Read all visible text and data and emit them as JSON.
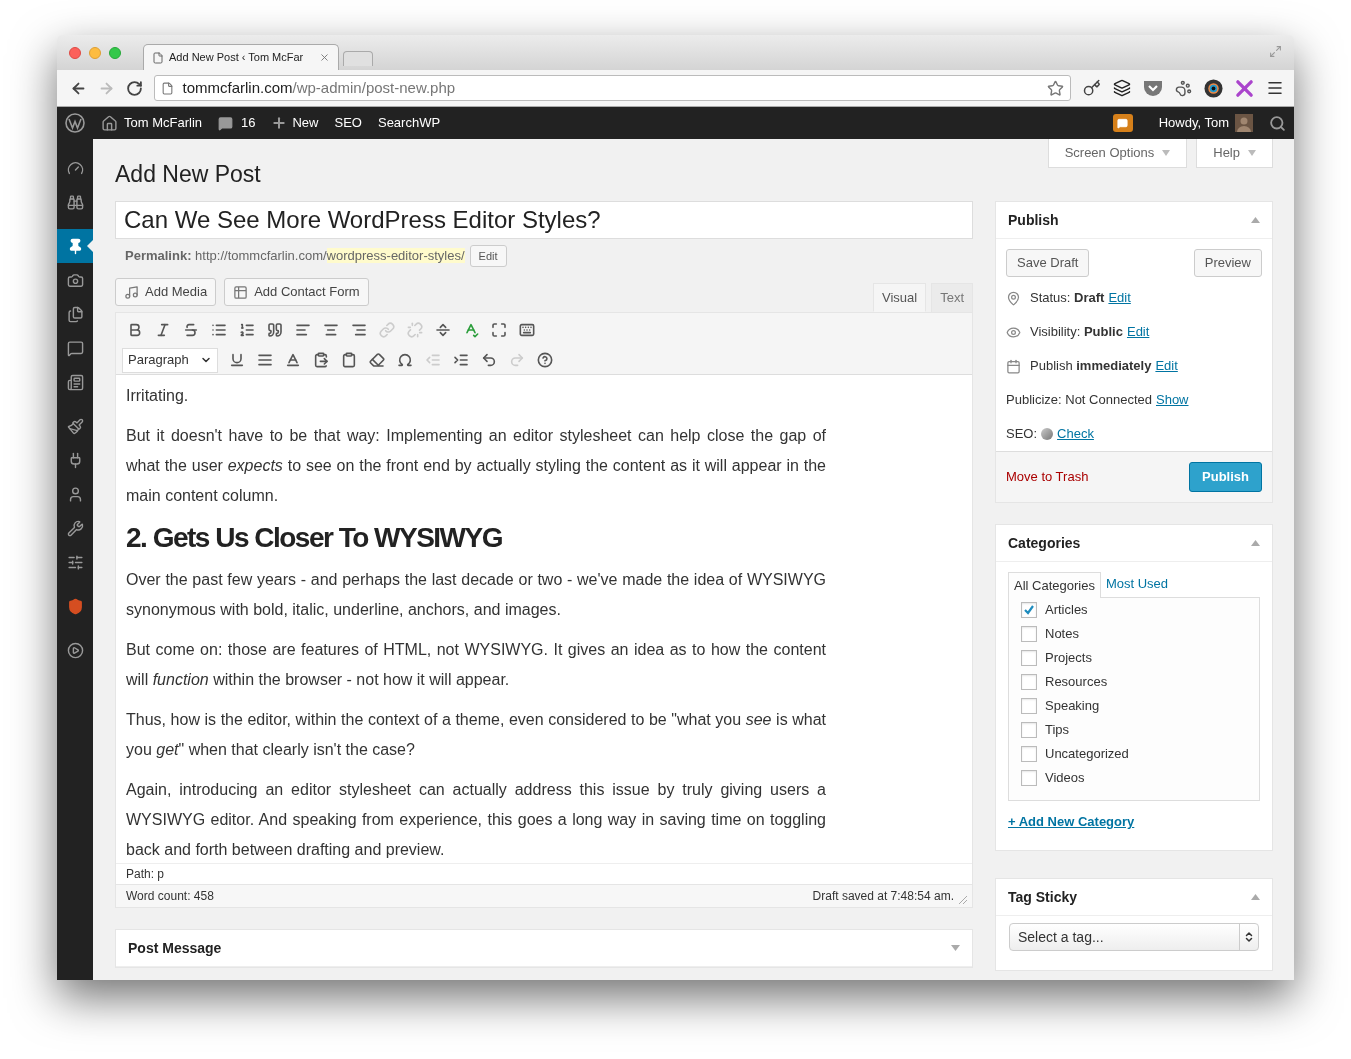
{
  "browser": {
    "tab_title": "Add New Post ‹ Tom McFar",
    "nav": [
      {
        "kind": "back",
        "disabled": false
      },
      {
        "kind": "forward",
        "disabled": true
      },
      {
        "kind": "reload",
        "disabled": false
      }
    ],
    "url_host": "tommcfarlin.com",
    "url_path": "/wp-admin/post-new.php",
    "extensions": [
      {
        "kind": "key"
      },
      {
        "kind": "layers"
      },
      {
        "kind": "pocket"
      },
      {
        "kind": "paw"
      },
      {
        "kind": "lens"
      },
      {
        "kind": "cross"
      },
      {
        "kind": "menu"
      }
    ]
  },
  "admin_bar": {
    "site": "Tom McFarlin",
    "comments": "16",
    "new": "New",
    "items": [
      "SEO",
      "SearchWP"
    ],
    "howdy": "Howdy, Tom"
  },
  "sidebar": {
    "groups": [
      [
        {
          "kind": "dashboard",
          "selected": false
        },
        {
          "kind": "binoculars",
          "selected": false
        }
      ],
      [
        {
          "kind": "posts",
          "selected": true
        },
        {
          "kind": "media",
          "selected": false
        },
        {
          "kind": "pages",
          "selected": false
        },
        {
          "kind": "comments",
          "selected": false
        },
        {
          "kind": "forms",
          "selected": false
        }
      ],
      [
        {
          "kind": "appearance",
          "selected": false
        },
        {
          "kind": "plugins",
          "selected": false
        },
        {
          "kind": "users",
          "selected": false
        },
        {
          "kind": "tools",
          "selected": false
        },
        {
          "kind": "settings",
          "selected": false
        }
      ],
      [
        {
          "kind": "shield",
          "selected": false
        }
      ],
      [
        {
          "kind": "play",
          "selected": false
        }
      ]
    ]
  },
  "screen_tabs": [
    "Screen Options",
    "Help"
  ],
  "page_title": "Add New Post",
  "post_title": "Can We See More WordPress Editor Styles?",
  "permalink": {
    "label": "Permalink:",
    "base": "http://tommcfarlin.com/",
    "slug": "wordpress-editor-styles/",
    "edit": "Edit"
  },
  "media_buttons": [
    {
      "kind": "media",
      "label": "Add Media"
    },
    {
      "kind": "form",
      "label": "Add Contact Form"
    }
  ],
  "editor_tabs": [
    {
      "label": "Visual",
      "selected": true
    },
    {
      "label": "Text",
      "selected": false
    }
  ],
  "toolbar": {
    "format": "Paragraph",
    "rows": [
      [
        {
          "kind": "bold",
          "disabled": false
        },
        {
          "kind": "italic",
          "disabled": false
        },
        {
          "kind": "strike",
          "disabled": false
        },
        {
          "kind": "bullets",
          "disabled": false
        },
        {
          "kind": "numbers",
          "disabled": false
        },
        {
          "kind": "quote",
          "disabled": false
        },
        {
          "kind": "align-left",
          "disabled": false
        },
        {
          "kind": "align-center",
          "disabled": false
        },
        {
          "kind": "align-right",
          "disabled": false
        },
        {
          "kind": "link",
          "disabled": true
        },
        {
          "kind": "unlink",
          "disabled": true
        },
        {
          "kind": "more",
          "disabled": false
        },
        {
          "kind": "spellcheck",
          "disabled": false
        },
        {
          "kind": "fullscreen",
          "disabled": false
        },
        {
          "kind": "keyboard",
          "disabled": false
        }
      ],
      [
        {
          "kind": "format",
          "disabled": false
        },
        {
          "kind": "underline",
          "disabled": false
        },
        {
          "kind": "justify",
          "disabled": false
        },
        {
          "kind": "text-color",
          "disabled": false
        },
        {
          "kind": "paste-text",
          "disabled": false
        },
        {
          "kind": "paste-word",
          "disabled": false
        },
        {
          "kind": "eraser",
          "disabled": false
        },
        {
          "kind": "omega",
          "disabled": false
        },
        {
          "kind": "outdent",
          "disabled": true
        },
        {
          "kind": "indent",
          "disabled": false
        },
        {
          "kind": "undo",
          "disabled": false
        },
        {
          "kind": "redo",
          "disabled": true
        },
        {
          "kind": "help",
          "disabled": false
        }
      ]
    ]
  },
  "content": [
    {
      "kind": "p",
      "text": "Irritating."
    },
    {
      "kind": "p",
      "text": "But it doesn't have to be that way: Implementing an editor stylesheet can help close the gap of what the user *expects* to see on the front end by actually styling the content as it will appear in the main content column."
    },
    {
      "kind": "h2",
      "text": "2. Gets Us Closer To WYSIWYG"
    },
    {
      "kind": "p",
      "text": "Over the past few years - and perhaps the last decade or two - we've made the idea of WYSIWYG synonymous with bold, italic, underline, anchors, and images."
    },
    {
      "kind": "p",
      "text": "But come on: those are features of HTML, not WYSIWYG. It gives an idea as to how the content will *function* within the browser - not how it will appear."
    },
    {
      "kind": "p",
      "text": "Thus, how is the editor, within the context of a theme, even considered to be \"what you *see* is what you *get*\" when that clearly isn't the case?"
    },
    {
      "kind": "p",
      "text": "Again, introducing an editor stylesheet can actually address this issue by truly giving users a WYSIWYG editor. And speaking from experience, this goes a long way in saving time on toggling back and forth between drafting and preview."
    }
  ],
  "path": "Path: p",
  "word_count": "Word count: 458",
  "draft_saved": "Draft saved at 7:48:54 am.",
  "post_message": {
    "title": "Post Message",
    "expanded": false
  },
  "publish": {
    "title": "Publish",
    "expanded": true,
    "save_draft": "Save Draft",
    "preview": "Preview",
    "rows": [
      {
        "kind": "status",
        "text": "Status: **Draft**",
        "link": "Edit"
      },
      {
        "kind": "visibility",
        "text": "Visibility: **Public**",
        "link": "Edit"
      },
      {
        "kind": "schedule",
        "text": "Publish **immediately**",
        "link": "Edit"
      },
      {
        "kind": "publicize",
        "text": "Publicize: Not Connected",
        "link": "Show"
      },
      {
        "kind": "seo",
        "text": "SEO:",
        "link": "Check"
      }
    ],
    "trash": "Move to Trash",
    "publish": "Publish"
  },
  "categories": {
    "title": "Categories",
    "expanded": true,
    "tabs": [
      {
        "label": "All Categories",
        "selected": true
      },
      {
        "label": "Most Used",
        "selected": false
      }
    ],
    "items": [
      {
        "label": "Articles",
        "checked": true
      },
      {
        "label": "Notes",
        "checked": false
      },
      {
        "label": "Projects",
        "checked": false
      },
      {
        "label": "Resources",
        "checked": false
      },
      {
        "label": "Speaking",
        "checked": false
      },
      {
        "label": "Tips",
        "checked": false
      },
      {
        "label": "Uncategorized",
        "checked": false
      },
      {
        "label": "Videos",
        "checked": false
      }
    ],
    "add": "+ Add New Category"
  },
  "tag_sticky": {
    "title": "Tag Sticky",
    "expanded": true,
    "select": "Select a tag..."
  }
}
